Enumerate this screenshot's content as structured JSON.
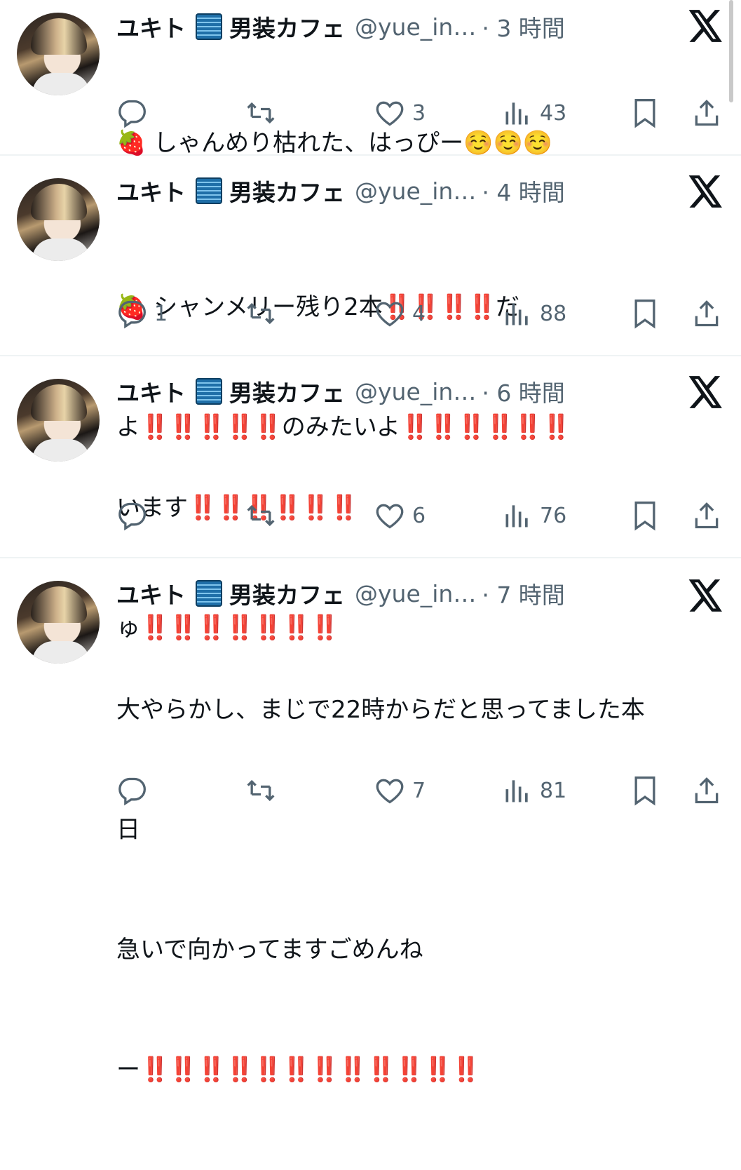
{
  "tweets": [
    {
      "name": "ユキト",
      "badge_icon": "xray-icon",
      "shop": "男装カフェ",
      "handle": "@yue_in…",
      "time": "· 3 時間",
      "lines": [
        "🍓 しゃんめり枯れた、はっぴー☺️☺️☺️"
      ],
      "reply_count": "",
      "like_count": "3",
      "view_count": "43"
    },
    {
      "name": "ユキト",
      "badge_icon": "xray-icon",
      "shop": "男装カフェ",
      "handle": "@yue_in…",
      "time": "· 4 時間",
      "lines": [
        "🍓 シャンメリー残り2本‼️‼️‼️‼️だ",
        "よ‼️‼️‼️‼️‼️のみたいよ‼️‼️‼️‼️‼️‼️"
      ],
      "reply_count": "1",
      "like_count": "4",
      "view_count": "88"
    },
    {
      "name": "ユキト",
      "badge_icon": "xray-icon",
      "shop": "男装カフェ",
      "handle": "@yue_in…",
      "time": "· 6 時間",
      "lines": [
        "います‼️‼️‼️‼️‼️‼️",
        "ゅ‼️‼️‼️‼️‼️‼️‼️"
      ],
      "reply_count": "",
      "like_count": "6",
      "view_count": "76"
    },
    {
      "name": "ユキト",
      "badge_icon": "xray-icon",
      "shop": "男装カフェ",
      "handle": "@yue_in…",
      "time": "· 7 時間",
      "lines": [
        "大やらかし、まじで22時からだと思ってました本",
        "日",
        "急いで向かってますごめんね",
        "ー‼️‼️‼️‼️‼️‼️‼️‼️‼️‼️‼️‼️"
      ],
      "reply_count": "",
      "like_count": "7",
      "view_count": "81"
    }
  ],
  "icons": {
    "reply": "reply-icon",
    "retweet": "retweet-icon",
    "like": "heart-icon",
    "views": "views-icon",
    "bookmark": "bookmark-icon",
    "share": "share-icon",
    "platform": "x-logo-icon"
  },
  "colors": {
    "text": "#0f1419",
    "muted": "#536471",
    "divider": "#eff3f4",
    "exclaim": "#e0242b"
  }
}
